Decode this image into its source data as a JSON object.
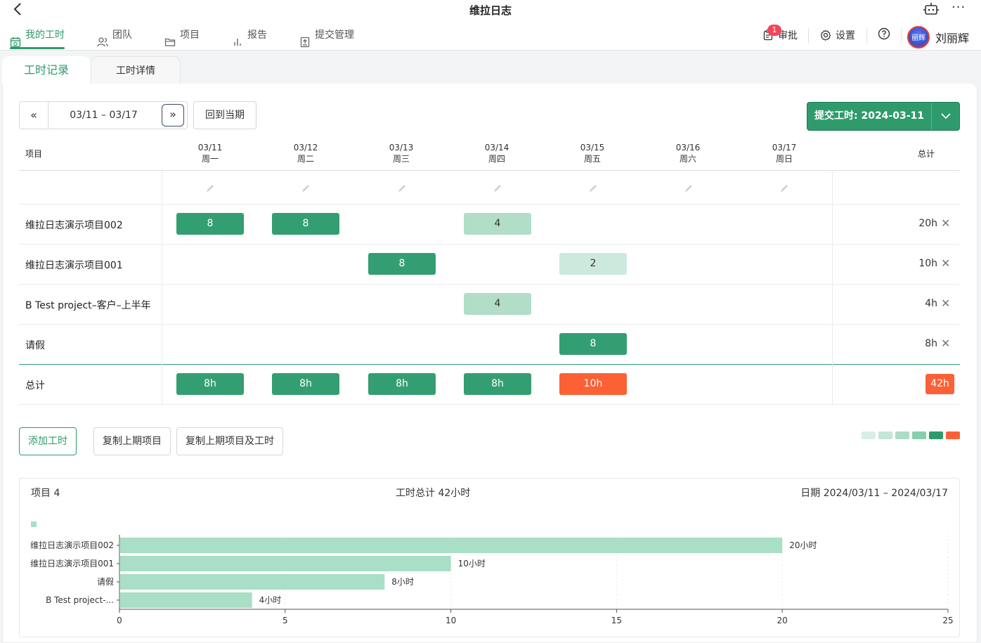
{
  "window": {
    "title": "维拉日志"
  },
  "nav": {
    "items": [
      {
        "label": "我的工时",
        "icon": "calendar-icon"
      },
      {
        "label": "团队",
        "icon": "team-icon"
      },
      {
        "label": "项目",
        "icon": "folder-icon"
      },
      {
        "label": "报告",
        "icon": "bar-chart-icon"
      },
      {
        "label": "提交管理",
        "icon": "upload-doc-icon"
      }
    ],
    "approval_label": "审批",
    "approval_badge": "1",
    "settings_label": "设置",
    "avatar_text": "丽辉",
    "username": "刘丽辉"
  },
  "tabs": {
    "records": "工时记录",
    "details": "工时详情"
  },
  "toolbar": {
    "date_range": "03/11 – 03/17",
    "back_current": "回到当期",
    "submit_label": "提交工时: 2024-03-11"
  },
  "grid": {
    "project_header": "项目",
    "total_header": "总计",
    "days": [
      {
        "date": "03/11",
        "weekday": "周一"
      },
      {
        "date": "03/12",
        "weekday": "周二"
      },
      {
        "date": "03/13",
        "weekday": "周三"
      },
      {
        "date": "03/14",
        "weekday": "周四"
      },
      {
        "date": "03/15",
        "weekday": "周五"
      },
      {
        "date": "03/16",
        "weekday": "周六"
      },
      {
        "date": "03/17",
        "weekday": "周日"
      }
    ],
    "rows": [
      {
        "name": "维拉日志演示项目002",
        "hours": [
          "8",
          "8",
          "",
          "4",
          "",
          "",
          ""
        ],
        "total": "20h"
      },
      {
        "name": "维拉日志演示项目001",
        "hours": [
          "",
          "",
          "8",
          "",
          "2",
          "",
          ""
        ],
        "total": "10h"
      },
      {
        "name": "B Test project–客户–上半年",
        "hours": [
          "",
          "",
          "",
          "4",
          "",
          "",
          ""
        ],
        "total": "4h"
      },
      {
        "name": "请假",
        "hours": [
          "",
          "",
          "",
          "",
          "8",
          "",
          ""
        ],
        "total": "8h"
      }
    ],
    "totals_label": "总计",
    "day_totals": [
      "8h",
      "8h",
      "8h",
      "8h",
      "10h",
      "",
      ""
    ],
    "grand_total": "42h"
  },
  "actions": {
    "add": "添加工时",
    "copy_projects": "复制上期项目",
    "copy_projects_hours": "复制上期项目及工时"
  },
  "colors": {
    "brand": "#2f9b6d",
    "over": "#fb6135",
    "legend": [
      "#d9efe6",
      "#c3e6d6",
      "#aadcc6",
      "#86cfae",
      "#2f9b6d",
      "#fb6135"
    ]
  },
  "summary": {
    "projects": "项目 4",
    "hours_total": "工时总计 42小时",
    "date_range": "日期 2024/03/11 – 2024/03/17"
  },
  "chart_data": {
    "type": "bar",
    "orientation": "horizontal",
    "categories": [
      "维拉日志演示项目002",
      "维拉日志演示项目001",
      "请假",
      "B Test project-..."
    ],
    "values": [
      20,
      10,
      8,
      4
    ],
    "value_labels": [
      "20小时",
      "10小时",
      "8小时",
      "4小时"
    ],
    "xlim": [
      0,
      25
    ],
    "xticks": [
      "0",
      "5",
      "10",
      "15",
      "20",
      "25"
    ],
    "bar_color": "#a8dfc6",
    "grid": true
  }
}
